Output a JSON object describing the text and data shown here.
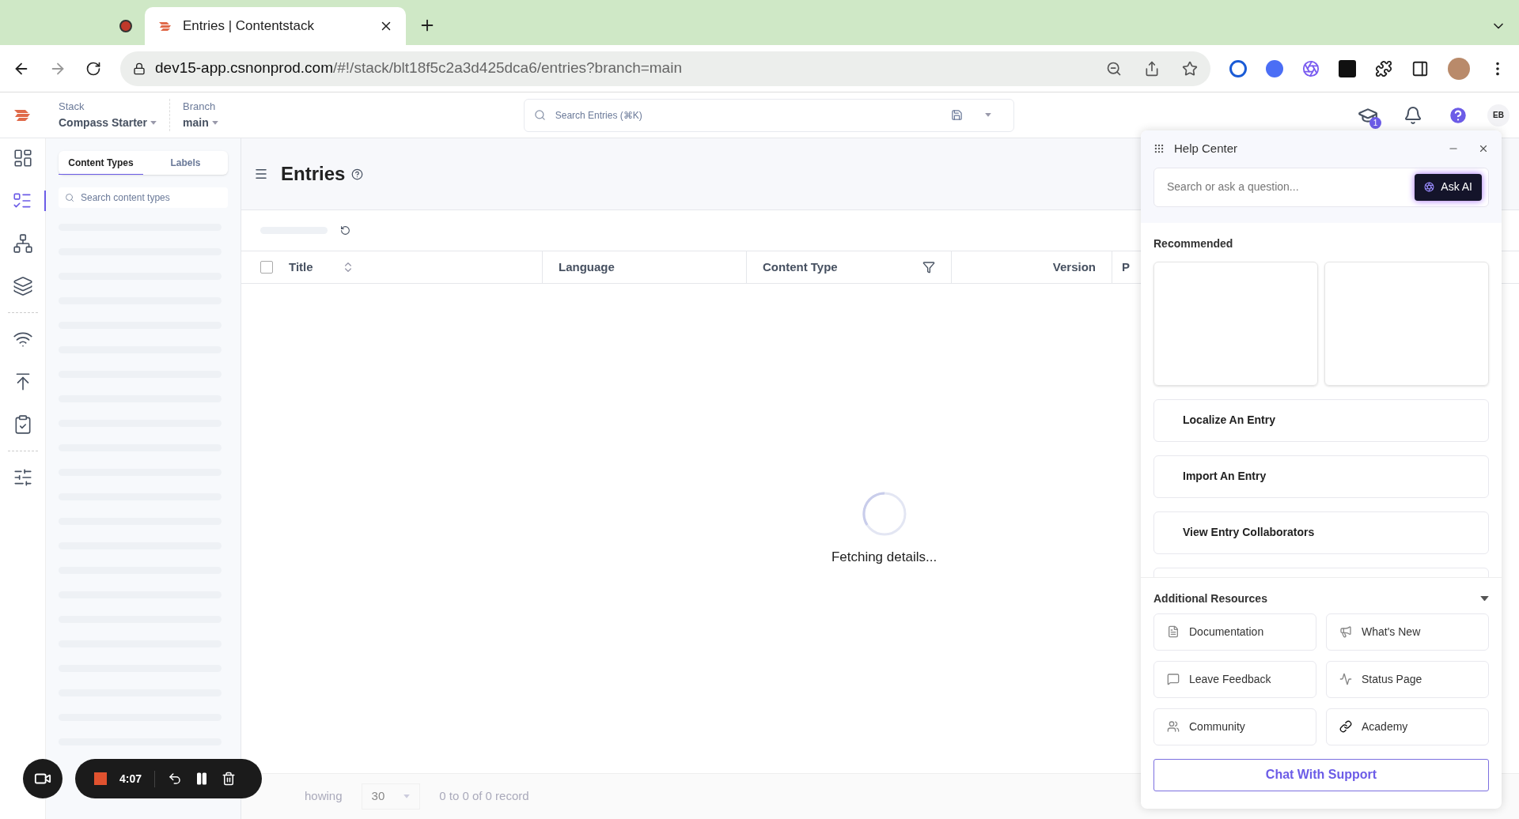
{
  "browser": {
    "tabs": [
      {
        "selected": false
      },
      {
        "title": "Entries | Contentstack",
        "selected": true
      }
    ],
    "url": {
      "host": "dev15-app.csnonprod.com",
      "path": "/#!/stack/blt18f5c2a3d425dca6/entries?branch=main"
    }
  },
  "header": {
    "stack_label": "Stack",
    "stack_value": "Compass Starter",
    "branch_label": "Branch",
    "branch_value": "main",
    "search_placeholder": "Search Entries (⌘K)",
    "notification_count": "1",
    "avatar": "EB"
  },
  "rail": [
    {
      "selected": false
    },
    {
      "selected": true
    },
    {
      "selected": false
    },
    {
      "selected": false
    },
    {
      "selected": false
    },
    {
      "selected": false
    },
    {
      "selected": false
    },
    {
      "selected": false
    }
  ],
  "content_panel": {
    "tabs": [
      {
        "label": "Content Types",
        "selected": true
      },
      {
        "label": "Labels",
        "selected": false
      }
    ],
    "search_placeholder": "Search content types"
  },
  "main": {
    "title": "Entries",
    "select_all_checked": false,
    "columns": [
      "Title",
      "Language",
      "Content Type",
      "Version",
      "P"
    ],
    "loading_text": "Fetching details...",
    "footer": {
      "showing": "howing",
      "page_size": "30",
      "records": "0 to 0 of 0 record"
    }
  },
  "help_center": {
    "title": "Help Center",
    "search_placeholder": "Search or ask a question...",
    "ask_ai": "Ask AI",
    "recommended_title": "Recommended",
    "articles": [
      "Localize An Entry",
      "Import An Entry",
      "View Entry Collaborators"
    ],
    "resources_title": "Additional Resources",
    "resources_expanded": true,
    "resources": [
      "Documentation",
      "What's New",
      "Leave Feedback",
      "Status Page",
      "Community",
      "Academy"
    ],
    "chat": "Chat With Support"
  },
  "recorder": {
    "time": "4:07"
  }
}
